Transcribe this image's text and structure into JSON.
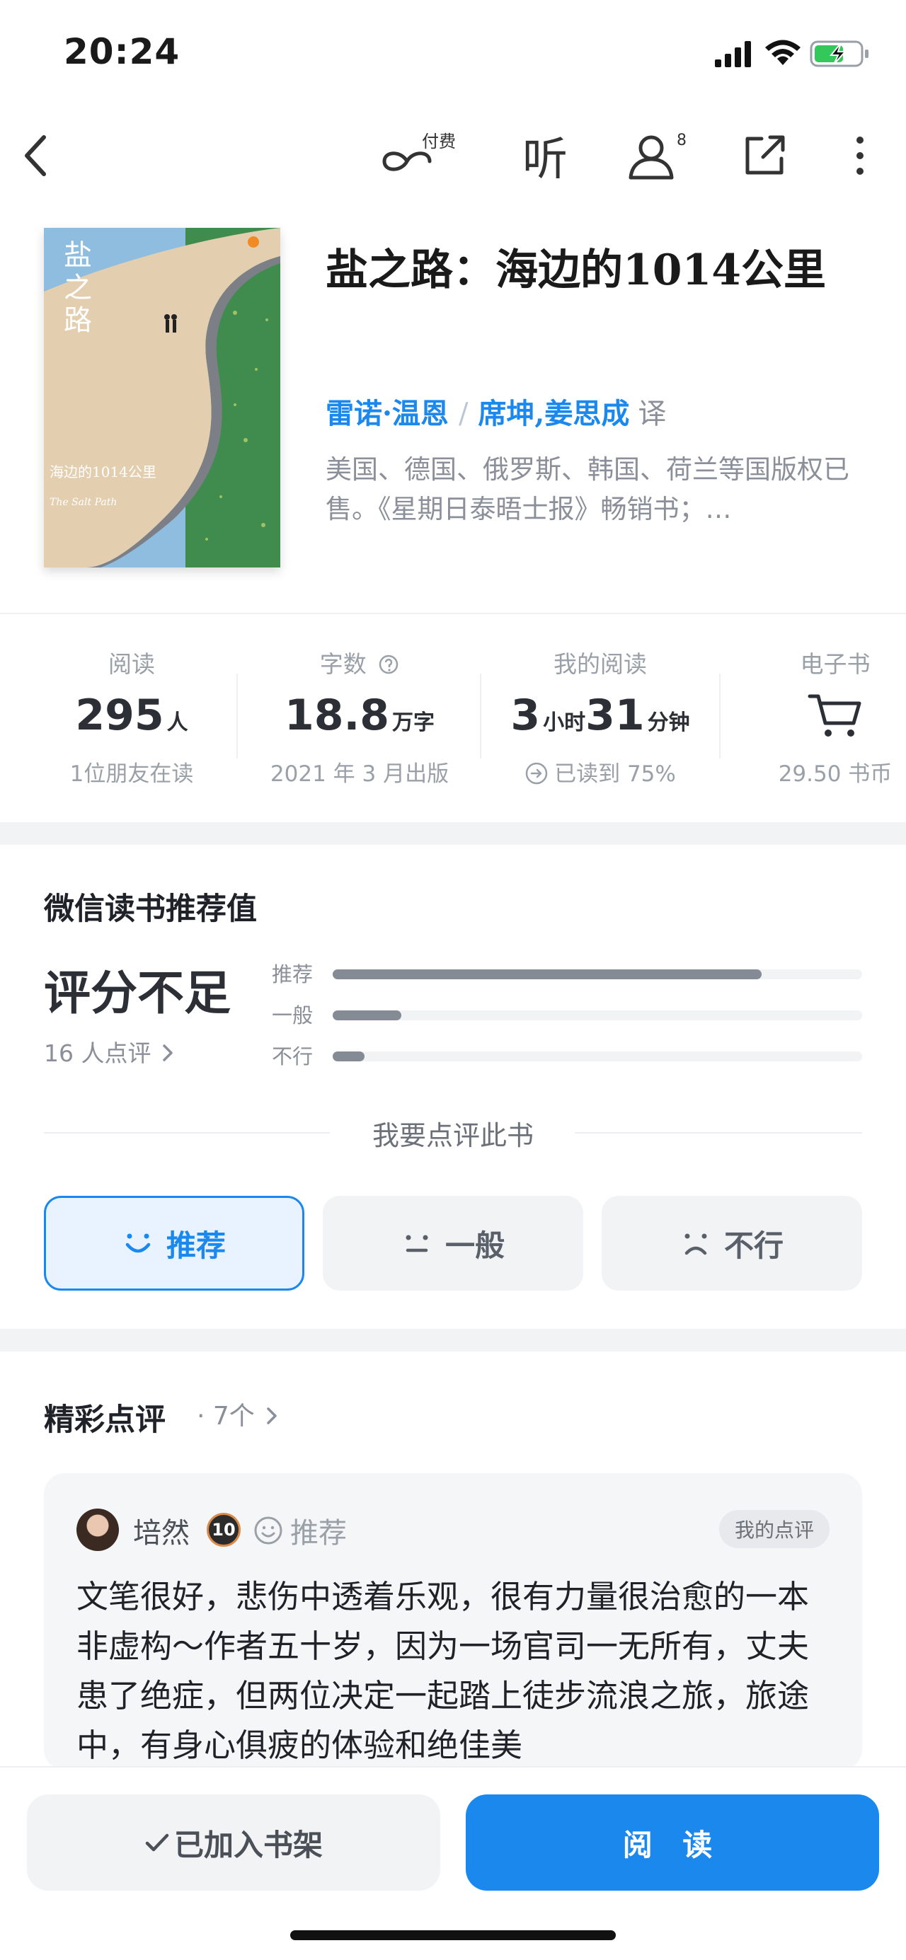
{
  "status": {
    "time": "20:24"
  },
  "nav": {
    "paid_badge": "付费",
    "listen": "听",
    "friends_count": "8"
  },
  "book": {
    "title": "盐之路：海边的1014公里",
    "author": "雷诺·温恩",
    "translators": "席坤,姜思成",
    "translator_role": "译",
    "description": "美国、德国、俄罗斯、韩国、荷兰等国版权已售。《星期日泰晤士报》畅销书；…",
    "cover": {
      "title_vertical": "盐之路",
      "subtitle": "海边的1014公里",
      "english": "The Salt Path"
    }
  },
  "stats": [
    {
      "label": "阅读",
      "value": "295",
      "unit": "人",
      "sub": "1位朋友在读"
    },
    {
      "label": "字数",
      "value": "18.8",
      "unit": "万字",
      "sub": "2021 年 3 月出版"
    },
    {
      "label": "我的阅读",
      "value_h": "3",
      "unit_h": "小时",
      "value_m": "31",
      "unit_m": "分钟",
      "sub": "已读到 75%"
    },
    {
      "label": "电子书",
      "sub": "29.50 书币"
    }
  ],
  "rating": {
    "section_title": "微信读书推荐值",
    "score_text": "评分不足",
    "reviewers": "16 人点评",
    "bars": [
      {
        "label": "推荐",
        "fraction": 0.81
      },
      {
        "label": "一般",
        "fraction": 0.13
      },
      {
        "label": "不行",
        "fraction": 0.06
      }
    ],
    "write_review": "我要点评此书",
    "buttons": {
      "recommend": "推荐",
      "average": "一般",
      "bad": "不行"
    }
  },
  "reviews": {
    "section_title": "精彩点评",
    "count_text": "· 7个",
    "items": [
      {
        "user": "培然",
        "level": "10",
        "tag": "推荐",
        "mine_label": "我的点评",
        "text": "文笔很好，悲伤中透着乐观，很有力量很治愈的一本非虚构～作者五十岁，因为一场官司一无所有，丈夫患了绝症，但两位决定一起踏上徒步流浪之旅，旅途中，有身心俱疲的体验和绝佳美"
      }
    ]
  },
  "bottom": {
    "shelf": "已加入书架",
    "read": "阅 读"
  },
  "colors": {
    "accent": "#1b88ee",
    "bar": "#858b95",
    "muted": "#8a8f99"
  }
}
